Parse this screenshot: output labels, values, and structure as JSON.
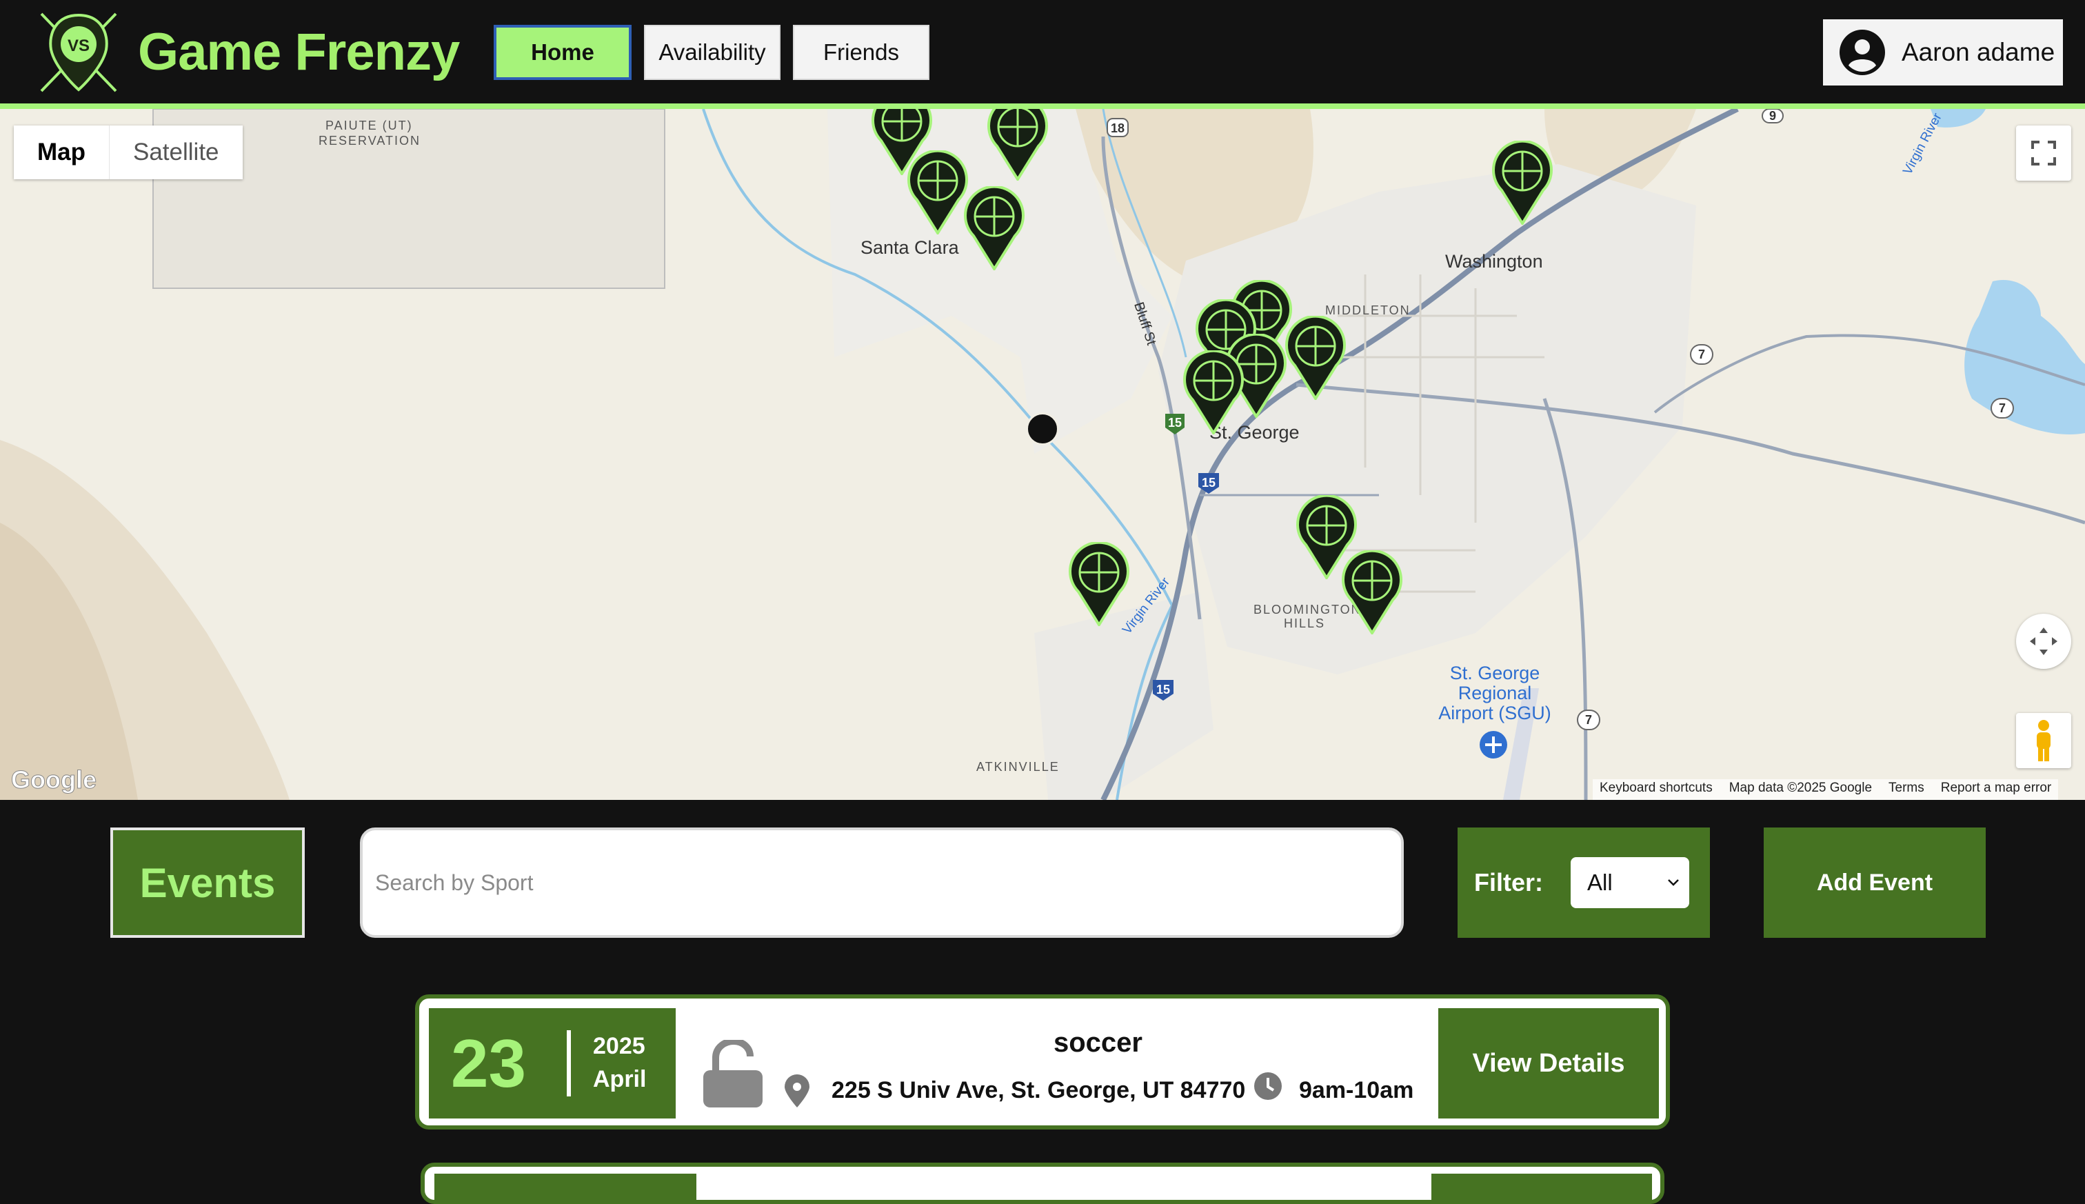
{
  "app": {
    "title": "Game Frenzy",
    "brand_color": "#a6f37a",
    "accent_dark": "#467322",
    "logo_text": "VS"
  },
  "nav": {
    "home": "Home",
    "availability": "Availability",
    "friends": "Friends",
    "active": "Home"
  },
  "user": {
    "name": "Aaron adame",
    "icon": "account-circle-icon"
  },
  "map": {
    "type_map": "Map",
    "type_satellite": "Satellite",
    "active_type": "Map",
    "places": {
      "santa_clara": "Santa Clara",
      "washington": "Washington",
      "st_george": "St. George",
      "middleton": "MIDDLETON",
      "bloomington_1": "BLOOMINGTON",
      "bloomington_2": "HILLS",
      "atkinville": "ATKINVILLE",
      "paiute_1": "PAIUTE (UT)",
      "paiute_2": "RESERVATION",
      "airport_1": "St. George",
      "airport_2": "Regional",
      "airport_3": "Airport (SGU)",
      "bluff": "Bluff St",
      "virgin_river": "Virgin River",
      "virgin_river_2": "Virgin River"
    },
    "highway_shields": [
      "18",
      "15",
      "15",
      "15",
      "7",
      "7",
      "7",
      "9"
    ],
    "attribution": {
      "shortcuts": "Keyboard shortcuts",
      "data": "Map data ©2025 Google",
      "terms": "Terms",
      "report": "Report a map error"
    },
    "google": "Google"
  },
  "events_section": {
    "label": "Events",
    "search_placeholder": "Search by Sport",
    "filter_label": "Filter:",
    "filter_value": "All",
    "add_button": "Add Event"
  },
  "events": [
    {
      "day": "23",
      "year": "2025",
      "month": "April",
      "sport": "soccer",
      "address": "225 S Univ Ave, St. George, UT 84770",
      "time": "9am-10am",
      "locked": false,
      "button": "View Details"
    }
  ]
}
